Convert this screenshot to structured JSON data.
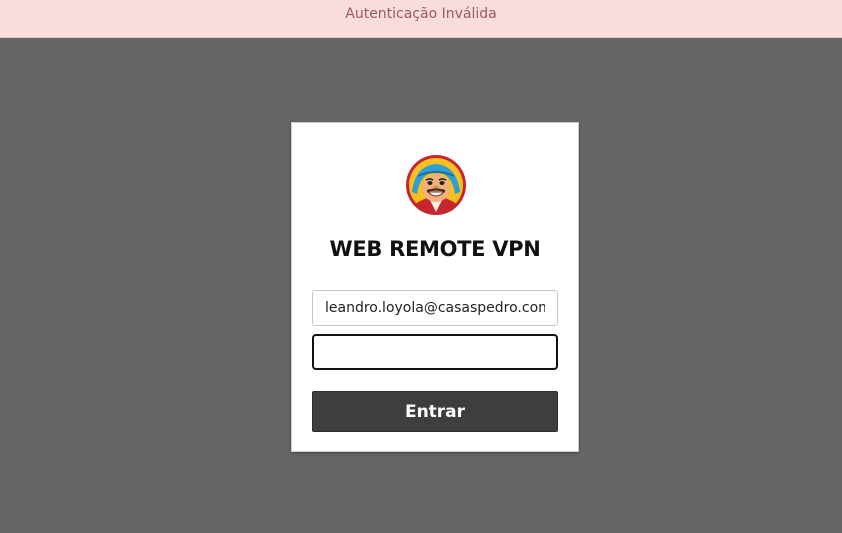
{
  "banner": {
    "message": "Autenticação Inválida"
  },
  "login": {
    "title": "WEB REMOTE VPN",
    "logo_icon": "cartoon-mascot-logo",
    "email_value": "leandro.loyola@casaspedro.com.br",
    "password_value": "",
    "submit_label": "Entrar"
  },
  "colors": {
    "page_background": "#666666",
    "banner_background": "#f9dcdc",
    "banner_text": "#9b5a5a",
    "button_background": "#3e3e3e"
  }
}
